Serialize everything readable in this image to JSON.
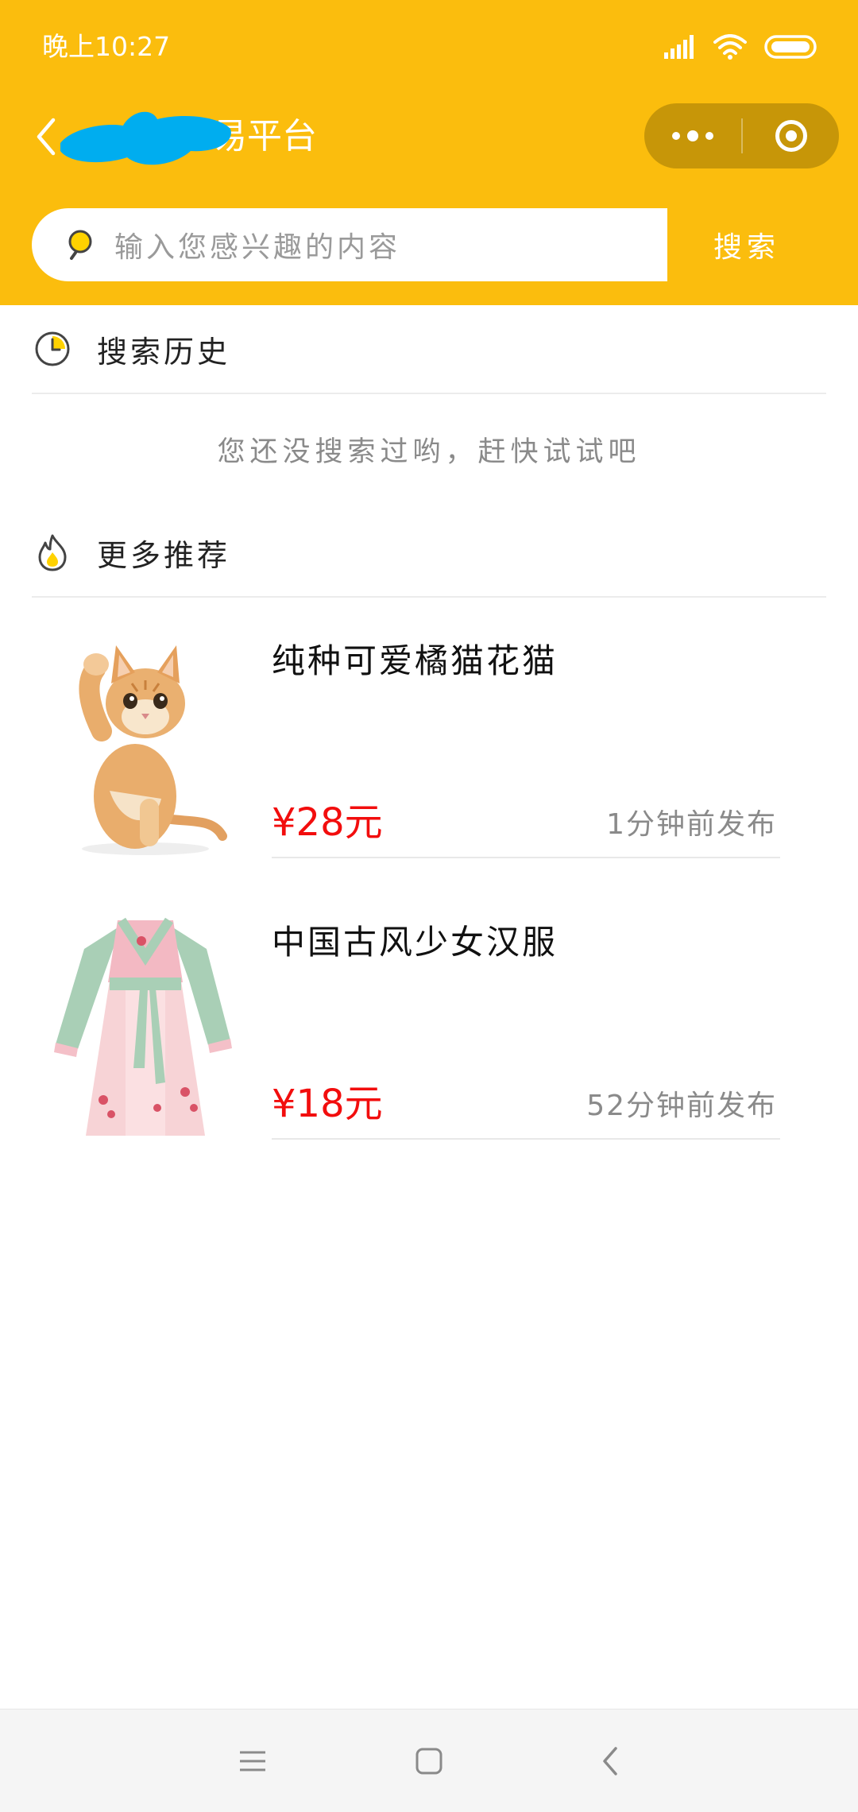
{
  "status_bar": {
    "time": "晚上10:27",
    "icons": [
      "signal-icon",
      "wifi-icon",
      "battery-icon"
    ]
  },
  "nav": {
    "title": "易平台",
    "back_icon": "chevron-left-icon",
    "capsule": [
      "more-icon",
      "close-miniprogram-icon"
    ]
  },
  "search": {
    "placeholder": "输入您感兴趣的内容",
    "button_label": "搜索"
  },
  "history": {
    "title": "搜索历史",
    "icon": "clock-icon",
    "empty_text": "您还没搜索过哟，赶快试试吧"
  },
  "recommend": {
    "title": "更多推荐",
    "icon": "flame-icon",
    "items": [
      {
        "name": "纯种可爱橘猫花猫",
        "price": "¥28元",
        "time": "1分钟前发布",
        "image": "orange-kitten"
      },
      {
        "name": "中国古风少女汉服",
        "price": "¥18元",
        "time": "52分钟前发布",
        "image": "hanfu-dress"
      }
    ]
  },
  "colors": {
    "header": "#fbbd0d",
    "price": "#f20d0d",
    "capsule": "#c79608"
  },
  "system_nav": [
    "menu-icon",
    "home-icon",
    "back-icon"
  ]
}
